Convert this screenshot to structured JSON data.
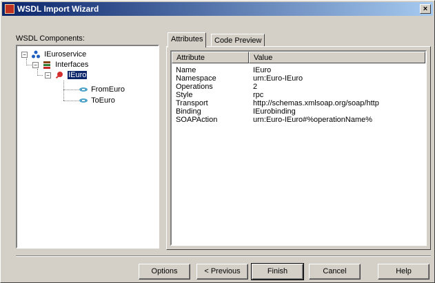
{
  "window": {
    "title": "WSDL Import Wizard",
    "close_label": "×"
  },
  "components": {
    "label": "WSDL Components:",
    "tree": [
      {
        "label": "IEuroservice",
        "icon": "service-icon",
        "level": 0
      },
      {
        "label": "Interfaces",
        "icon": "interfaces-icon",
        "level": 1
      },
      {
        "label": "IEuro",
        "icon": "interface-icon",
        "level": 2,
        "selected": true
      },
      {
        "label": "FromEuro",
        "icon": "method-icon",
        "level": 3
      },
      {
        "label": "ToEuro",
        "icon": "method-icon",
        "level": 3
      }
    ]
  },
  "tabs": [
    {
      "label": "Attributes",
      "active": true
    },
    {
      "label": "Code Preview",
      "active": false
    }
  ],
  "table": {
    "columns": [
      "Attribute",
      "Value"
    ],
    "rows": [
      {
        "attribute": "Name",
        "value": "IEuro"
      },
      {
        "attribute": "Namespace",
        "value": "urn:Euro-IEuro"
      },
      {
        "attribute": "Operations",
        "value": "2"
      },
      {
        "attribute": "Style",
        "value": "rpc"
      },
      {
        "attribute": "Transport",
        "value": "http://schemas.xmlsoap.org/soap/http"
      },
      {
        "attribute": "Binding",
        "value": "IEurobinding"
      },
      {
        "attribute": "SOAPAction",
        "value": "urn:Euro-IEuro#%operationName%"
      }
    ]
  },
  "buttons": {
    "options": "Options",
    "previous": "< Previous",
    "finish": "Finish",
    "cancel": "Cancel",
    "help": "Help"
  }
}
